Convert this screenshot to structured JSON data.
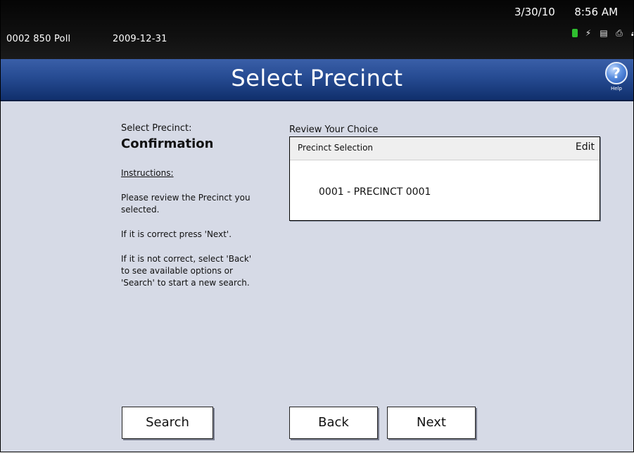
{
  "status_bar": {
    "poll_id": "0002 850 Poll",
    "poll_date": "2009-12-31",
    "date": "3/30/10",
    "time": "8:56 AM",
    "icons": [
      "battery-icon",
      "power-plug-icon",
      "memory-card-icon",
      "printer-icon",
      "lock-icon"
    ]
  },
  "header": {
    "title": "Select Precinct",
    "help_label": "Help",
    "help_symbol": "?"
  },
  "left_panel": {
    "screen_label": "Select Precinct:",
    "screen_sub": "Confirmation",
    "instructions_heading": "Instructions:",
    "instruction_1": "Please review the Precinct you selected.",
    "instruction_2": "If it is correct press 'Next'.",
    "instruction_3": "If it is not correct, select 'Back' to see available options or 'Search' to start a new search."
  },
  "review": {
    "label": "Review Your Choice",
    "header": "Precinct Selection",
    "edit_label": "Edit",
    "selected": "0001 - PRECINCT 0001"
  },
  "buttons": {
    "search": "Search",
    "back": "Back",
    "next": "Next"
  },
  "colors": {
    "title_bar": "#264b92",
    "top_bar": "#0a0a0a",
    "content_bg": "#d6dae6",
    "battery": "#2fbf2f"
  }
}
